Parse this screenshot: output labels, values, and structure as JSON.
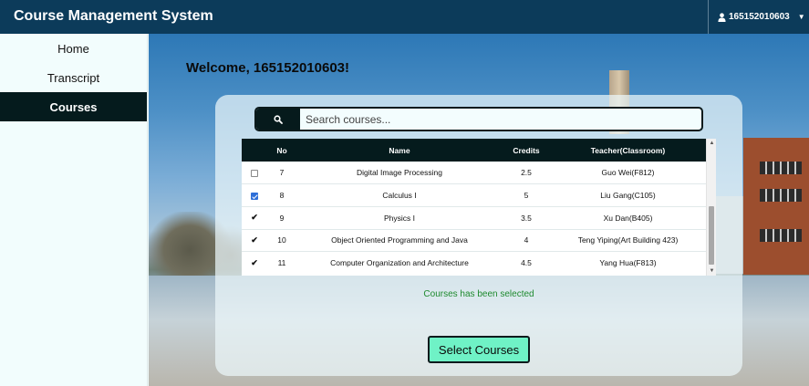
{
  "header": {
    "app_title": "Course Management System",
    "user_label": "165152010603",
    "user_icon": "user-icon",
    "caret_icon": "caret-down-icon"
  },
  "sidebar": {
    "items": [
      {
        "label": "Home",
        "active": false
      },
      {
        "label": "Transcript",
        "active": false
      },
      {
        "label": "Courses",
        "active": true
      }
    ]
  },
  "main": {
    "welcome": "Welcome, 165152010603!",
    "search": {
      "placeholder": "Search courses...",
      "value": "",
      "icon": "search-icon"
    },
    "table": {
      "columns": [
        "",
        "No",
        "Name",
        "Credits",
        "Teacher(Classroom)"
      ],
      "rows": [
        {
          "state": "unchecked",
          "no": "7",
          "name": "Digital Image Processing",
          "credits": "2.5",
          "teacher": "Guo Wei(F812)"
        },
        {
          "state": "checked",
          "no": "8",
          "name": "Calculus I",
          "credits": "5",
          "teacher": "Liu Gang(C105)"
        },
        {
          "state": "selected",
          "no": "9",
          "name": "Physics I",
          "credits": "3.5",
          "teacher": "Xu Dan(B405)"
        },
        {
          "state": "selected",
          "no": "10",
          "name": "Object Oriented Programming and Java",
          "credits": "4",
          "teacher": "Teng Yiping(Art Building 423)"
        },
        {
          "state": "selected",
          "no": "11",
          "name": "Computer Organization and Architecture",
          "credits": "4.5",
          "teacher": "Yang Hua(F813)"
        }
      ]
    },
    "status_message": "Courses has been selected",
    "select_button": "Select Courses"
  },
  "colors": {
    "topbar": "#0c3b5a",
    "sidebar_active": "#051b1d",
    "select_button": "#6ff2c6",
    "status_text": "#1e8a2e"
  }
}
